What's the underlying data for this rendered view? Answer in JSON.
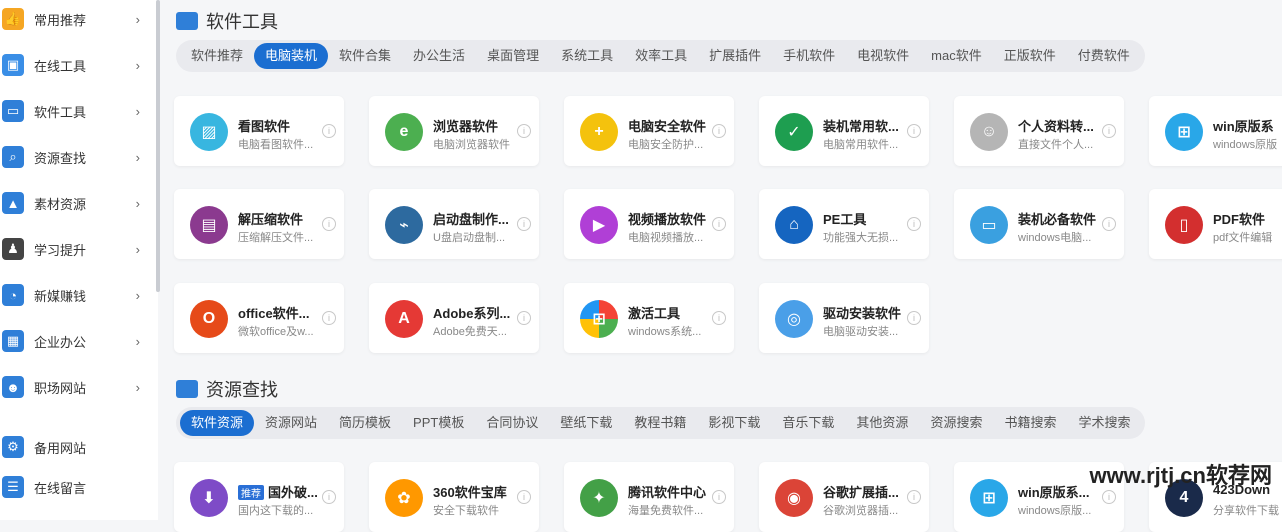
{
  "sidebar": {
    "items": [
      {
        "label": "常用推荐",
        "icon": "thumbs-up-icon",
        "color": "#f5a623",
        "glyph": "👍"
      },
      {
        "label": "在线工具",
        "icon": "toolbox-icon",
        "color": "#3a8ee6",
        "glyph": "▣"
      },
      {
        "label": "软件工具",
        "icon": "monitor-icon",
        "color": "#2f7fd8",
        "glyph": "▭"
      },
      {
        "label": "资源查找",
        "icon": "search-icon",
        "color": "#2f7fd8",
        "glyph": "⌕"
      },
      {
        "label": "素材资源",
        "icon": "image-icon",
        "color": "#2f7fd8",
        "glyph": "▲"
      },
      {
        "label": "学习提升",
        "icon": "graduate-icon",
        "color": "#444",
        "glyph": "♟"
      },
      {
        "label": "新媒赚钱",
        "icon": "pie-chart-icon",
        "color": "#2f7fd8",
        "glyph": "◔"
      },
      {
        "label": "企业办公",
        "icon": "building-icon",
        "color": "#2f7fd8",
        "glyph": "▦"
      },
      {
        "label": "职场网站",
        "icon": "users-icon",
        "color": "#2f7fd8",
        "glyph": "☻"
      },
      {
        "label": "备用网站",
        "icon": "gear-icon",
        "color": "#2f7fd8",
        "glyph": "⚙"
      },
      {
        "label": "在线留言",
        "icon": "chat-icon",
        "color": "#2f7fd8",
        "glyph": "☰"
      }
    ]
  },
  "software": {
    "title": "软件工具",
    "tabs": [
      "软件推荐",
      "电脑装机",
      "软件合集",
      "办公生活",
      "桌面管理",
      "系统工具",
      "效率工具",
      "扩展插件",
      "手机软件",
      "电视软件",
      "mac软件",
      "正版软件",
      "付费软件"
    ],
    "active_tab": 1,
    "cards": [
      {
        "title": "看图软件",
        "sub": "电脑看图软件...",
        "icon": "image-viewer-icon",
        "color": "#38b6e0",
        "glyph": "▨"
      },
      {
        "title": "浏览器软件",
        "sub": "电脑浏览器软件",
        "icon": "browser-icon",
        "color": "#4caf50",
        "glyph": "e"
      },
      {
        "title": "电脑安全软件",
        "sub": "电脑安全防护...",
        "icon": "security-icon",
        "color": "#f4c20d",
        "glyph": "+"
      },
      {
        "title": "装机常用软...",
        "sub": "电脑常用软件...",
        "icon": "shield-check-icon",
        "color": "#1e9e50",
        "glyph": "✓"
      },
      {
        "title": "个人资料转...",
        "sub": "直接文件个人...",
        "icon": "profile-icon",
        "color": "#b5b5b5",
        "glyph": "☺"
      },
      {
        "title": "win原版系",
        "sub": "windows原版",
        "icon": "windows-icon",
        "color": "#29a7e8",
        "glyph": "⊞"
      },
      {
        "title": "解压缩软件",
        "sub": "压缩解压文件...",
        "icon": "archive-icon",
        "color": "#8b3a8f",
        "glyph": "▤"
      },
      {
        "title": "启动盘制作...",
        "sub": "U盘启动盘制...",
        "icon": "usb-icon",
        "color": "#2d6a9f",
        "glyph": "⌁"
      },
      {
        "title": "视频播放软件",
        "sub": "电脑视频播放...",
        "icon": "play-icon",
        "color": "#b03fd6",
        "glyph": "▶"
      },
      {
        "title": "PE工具",
        "sub": "功能强大无损...",
        "icon": "pe-icon",
        "color": "#1565c0",
        "glyph": "⌂"
      },
      {
        "title": "装机必备软件",
        "sub": "windows电脑...",
        "icon": "desktop-icon",
        "color": "#3aa0e0",
        "glyph": "▭"
      },
      {
        "title": "PDF软件",
        "sub": "pdf文件编辑",
        "icon": "pdf-icon",
        "color": "#d32f2f",
        "glyph": "▯"
      },
      {
        "title": "office软件...",
        "sub": "微软office及w...",
        "icon": "office-icon",
        "color": "#e64a19",
        "glyph": "O"
      },
      {
        "title": "Adobe系列...",
        "sub": "Adobe免费天...",
        "icon": "adobe-icon",
        "color": "#e53935",
        "glyph": "A"
      },
      {
        "title": "激活工具",
        "sub": "windows系统...",
        "icon": "activation-icon",
        "color": "#ffffff",
        "glyph": "⊞"
      },
      {
        "title": "驱动安装软件",
        "sub": "电脑驱动安装...",
        "icon": "driver-icon",
        "color": "#4a9fe8",
        "glyph": "◎"
      }
    ]
  },
  "resources": {
    "title": "资源查找",
    "tabs": [
      "软件资源",
      "资源网站",
      "简历模板",
      "PPT模板",
      "合同协议",
      "壁纸下载",
      "教程书籍",
      "影视下载",
      "音乐下载",
      "其他资源",
      "资源搜索",
      "书籍搜索",
      "学术搜索"
    ],
    "active_tab": 0,
    "cards": [
      {
        "title": "国外破...",
        "badge": "推荐",
        "sub": "国内这下载的...",
        "icon": "download-icon",
        "color": "#7e4bc7",
        "glyph": "⬇"
      },
      {
        "title": "360软件宝库",
        "sub": "安全下载软件",
        "icon": "360-icon",
        "color": "#ff9800",
        "glyph": "✿"
      },
      {
        "title": "腾讯软件中心",
        "sub": "海量免费软件...",
        "icon": "tencent-icon",
        "color": "#43a047",
        "glyph": "✦"
      },
      {
        "title": "谷歌扩展插...",
        "sub": "谷歌浏览器插...",
        "icon": "chrome-icon",
        "color": "#db4437",
        "glyph": "◉"
      },
      {
        "title": "win原版系...",
        "sub": "windows原版...",
        "icon": "windows-icon",
        "color": "#29a7e8",
        "glyph": "⊞"
      },
      {
        "title": "423Down",
        "sub": "分享软件下载",
        "icon": "423down-icon",
        "color": "#1a2a4a",
        "glyph": "4"
      }
    ]
  },
  "watermark": "www.rjtj.cn软荐网"
}
